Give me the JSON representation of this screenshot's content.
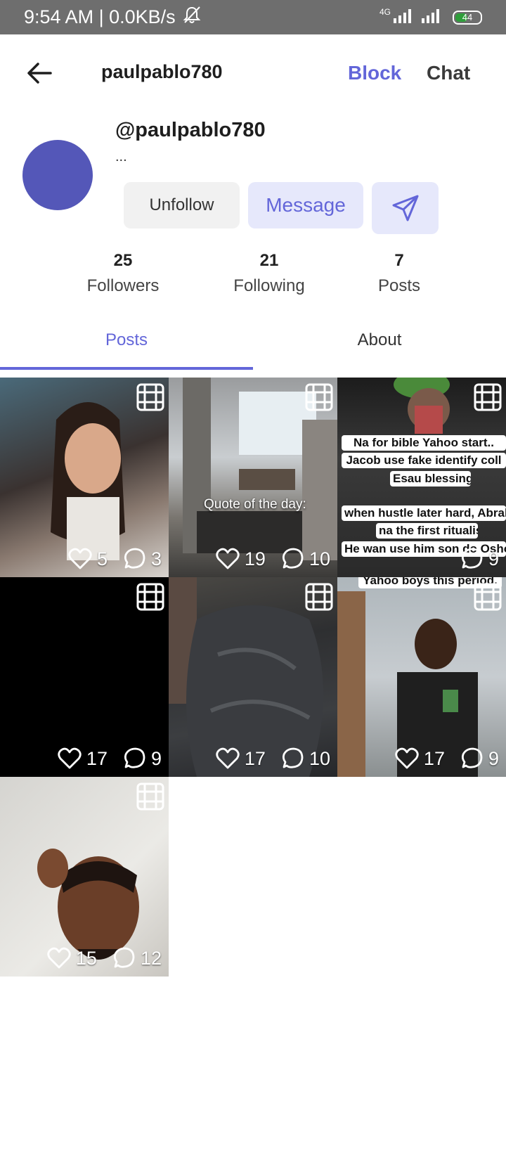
{
  "status_bar": {
    "time_speed": "9:54 AM | 0.0KB/s",
    "network": "4G",
    "battery": "44"
  },
  "header": {
    "title": "paulpablo780",
    "block_label": "Block",
    "chat_label": "Chat"
  },
  "profile": {
    "handle": "@paulpablo780",
    "bio": "...",
    "avatar_color": "#5457b8",
    "unfollow_label": "Unfollow",
    "message_label": "Message"
  },
  "stats": [
    {
      "value": "25",
      "label": "Followers"
    },
    {
      "value": "21",
      "label": "Following"
    },
    {
      "value": "7",
      "label": "Posts"
    }
  ],
  "tabs": [
    {
      "label": "Posts",
      "active": true
    },
    {
      "label": "About",
      "active": false
    }
  ],
  "accent_color": "#6366d9",
  "posts": [
    {
      "likes": "5",
      "comments": "3"
    },
    {
      "likes": "19",
      "comments": "10",
      "caption": "Quote of the day:"
    },
    {
      "likes": "",
      "comments": "9",
      "overlay_lines": [
        "Na for bible Yahoo start..",
        "Jacob use fake identify coll",
        "Esau blessings",
        "when hustle later hard, Abrah",
        "na the first ritualist...",
        "He wan use him son do Osho",
        "Yahoo boys this period."
      ]
    },
    {
      "likes": "17",
      "comments": "9"
    },
    {
      "likes": "17",
      "comments": "10"
    },
    {
      "likes": "17",
      "comments": "9"
    },
    {
      "likes": "15",
      "comments": "12"
    }
  ]
}
